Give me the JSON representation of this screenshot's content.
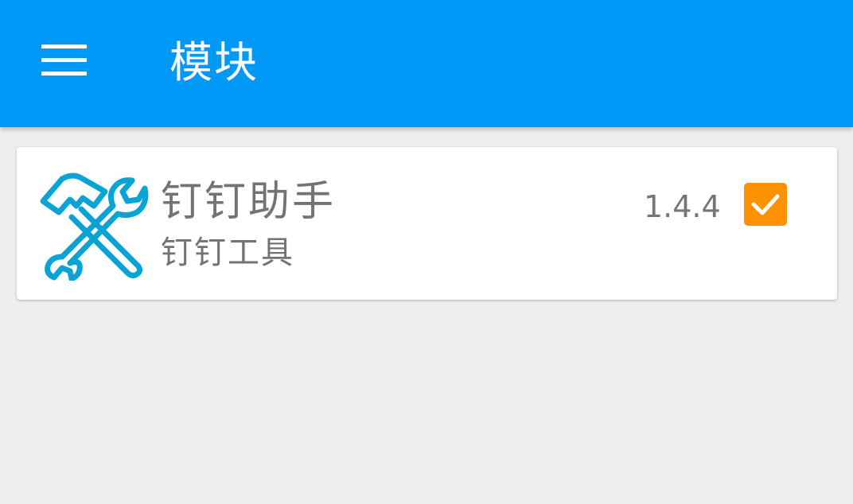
{
  "appbar": {
    "title": "模块",
    "menu_icon": "hamburger-menu-icon",
    "background_color": "#0199f7"
  },
  "modules": [
    {
      "icon": "tools-wrench-hammer-icon",
      "icon_color": "#0aa3d6",
      "name": "钉钉助手",
      "description": "钉钉工具",
      "version": "1.4.4",
      "enabled": true,
      "checkbox_color": "#fc9200"
    }
  ]
}
